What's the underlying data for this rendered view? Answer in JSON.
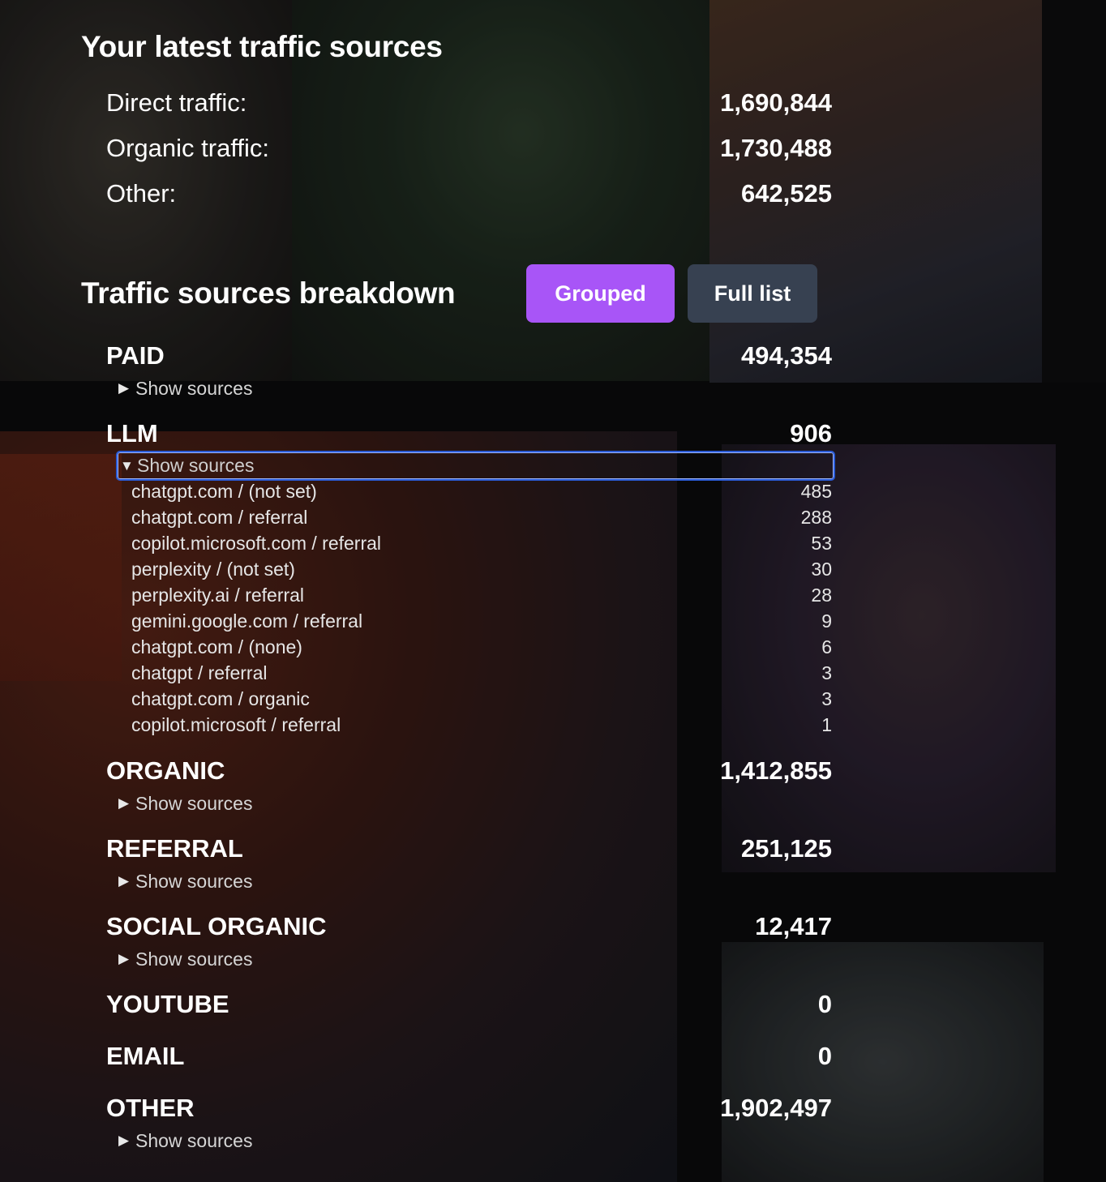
{
  "summary": {
    "title": "Your latest traffic sources",
    "rows": [
      {
        "label": "Direct traffic:",
        "value": "1,690,844"
      },
      {
        "label": "Organic traffic:",
        "value": "1,730,488"
      },
      {
        "label": "Other:",
        "value": "642,525"
      }
    ]
  },
  "breakdown": {
    "title": "Traffic sources breakdown",
    "grouped_label": "Grouped",
    "full_list_label": "Full list",
    "show_sources_label": "Show sources",
    "collapsed_marker": "▶",
    "expanded_marker": "▼",
    "groups": [
      {
        "name": "PAID",
        "value": "494,354"
      },
      {
        "name": "LLM",
        "value": "906"
      },
      {
        "name": "ORGANIC",
        "value": "1,412,855"
      },
      {
        "name": "REFERRAL",
        "value": "251,125"
      },
      {
        "name": "SOCIAL ORGANIC",
        "value": "12,417"
      },
      {
        "name": "YOUTUBE",
        "value": "0"
      },
      {
        "name": "EMAIL",
        "value": "0"
      },
      {
        "name": "OTHER",
        "value": "1,902,497"
      }
    ],
    "llm_sources": [
      {
        "source": "chatgpt.com / (not set)",
        "value": "485"
      },
      {
        "source": "chatgpt.com / referral",
        "value": "288"
      },
      {
        "source": "copilot.microsoft.com / referral",
        "value": "53"
      },
      {
        "source": "perplexity / (not set)",
        "value": "30"
      },
      {
        "source": "perplexity.ai / referral",
        "value": "28"
      },
      {
        "source": "gemini.google.com / referral",
        "value": "9"
      },
      {
        "source": "chatgpt.com / (none)",
        "value": "6"
      },
      {
        "source": "chatgpt / referral",
        "value": "3"
      },
      {
        "source": "chatgpt.com / organic",
        "value": "3"
      },
      {
        "source": "copilot.microsoft / referral",
        "value": "1"
      }
    ]
  },
  "colors": {
    "accent": "#a855f7",
    "secondary_button": "#374151",
    "focus_ring": "#2a5bd7"
  }
}
